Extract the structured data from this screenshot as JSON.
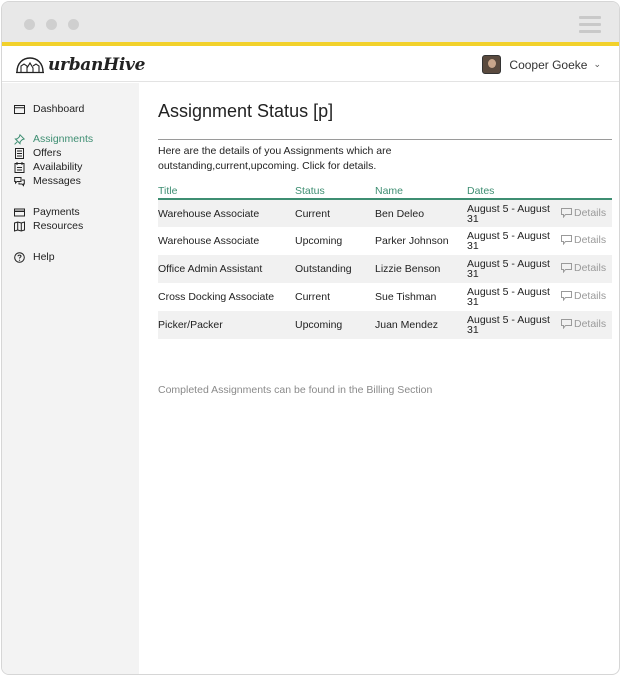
{
  "app": {
    "logo_text": "urbanHive"
  },
  "user": {
    "name": "Cooper Goeke",
    "chevron": "⌄"
  },
  "sidebar": {
    "items": [
      {
        "label": "Dashboard",
        "icon": "dashboard-icon"
      },
      {
        "label": "Assignments",
        "icon": "pin-icon",
        "active": true
      },
      {
        "label": "Offers",
        "icon": "document-icon"
      },
      {
        "label": "Availability",
        "icon": "calendar-icon"
      },
      {
        "label": "Messages",
        "icon": "chat-icon"
      },
      {
        "label": "Payments",
        "icon": "card-icon"
      },
      {
        "label": "Resources",
        "icon": "map-icon"
      },
      {
        "label": "Help",
        "icon": "help-icon"
      }
    ]
  },
  "main": {
    "title": "Assignment Status [p]",
    "intro": "Here are the details of you Assignments which are outstanding,current,upcoming. Click for details.",
    "table": {
      "headers": [
        "Title",
        "Status",
        "Name",
        "Dates"
      ],
      "details_label": "Details",
      "rows": [
        {
          "title": "Warehouse Associate",
          "status": "Current",
          "name": "Ben Deleo",
          "dates": "August 5 - August 31"
        },
        {
          "title": "Warehouse Associate",
          "status": "Upcoming",
          "name": "Parker Johnson",
          "dates": "August 5 - August 31"
        },
        {
          "title": "Office Admin Assistant",
          "status": "Outstanding",
          "name": "Lizzie Benson",
          "dates": "August 5 - August 31"
        },
        {
          "title": "Cross Docking Associate",
          "status": "Current",
          "name": "Sue Tishman",
          "dates": "August 5 - August 31"
        },
        {
          "title": "Picker/Packer",
          "status": "Upcoming",
          "name": "Juan Mendez",
          "dates": "August 5 - August 31"
        }
      ]
    },
    "footer_note": "Completed Assignments can be found in the Billing Section"
  },
  "colors": {
    "accent": "#3e8e72",
    "chrome_bar": "#f2d12b",
    "sidebar_bg": "#f3f3f3",
    "row_stripe": "#f1f1f1"
  }
}
